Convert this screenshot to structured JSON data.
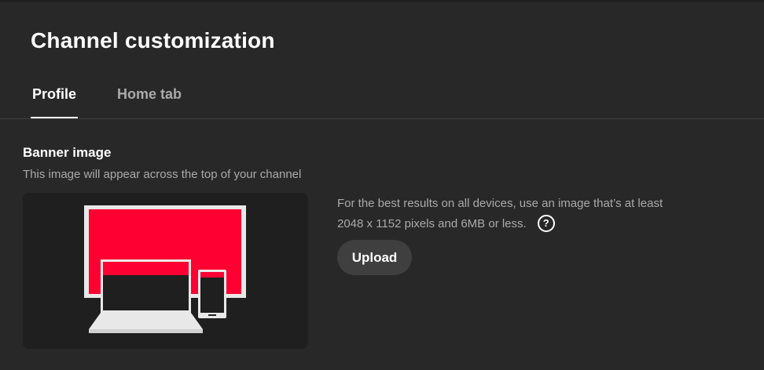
{
  "header": {
    "title": "Channel customization"
  },
  "tabs": [
    {
      "label": "Profile",
      "selected": true
    },
    {
      "label": "Home tab",
      "selected": false
    }
  ],
  "banner_section": {
    "title": "Banner image",
    "subtitle": "This image will appear across the top of your channel",
    "info_text": "For the best results on all devices, use an image that’s at least 2048 x 1152 pixels and 6MB or less.",
    "help_icon": "help-circle-icon",
    "upload_label": "Upload",
    "preview_icon": "devices-banner-illustration"
  },
  "colors": {
    "background": "#282828",
    "banner_accent": "#ff0033",
    "preview_background": "#1f1f1f",
    "button_background": "#3f3f3f"
  }
}
